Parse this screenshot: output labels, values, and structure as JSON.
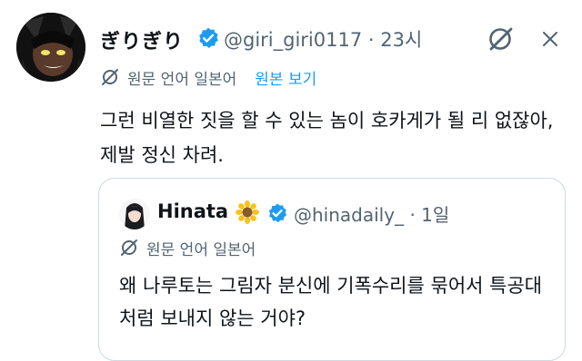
{
  "tweet": {
    "display_name": "ぎりぎり",
    "handle": "@giri_giri0117",
    "separator": "·",
    "time": "23시",
    "translation": {
      "language_note": "원문 언어 일본어",
      "show_original": "원본 보기"
    },
    "text": "그런 비열한 짓을 할 수 있는 놈이 호카게가 될 리 없잖아, 제발 정신 차려."
  },
  "quote": {
    "display_name": "Hinata",
    "handle": "@hinadaily_",
    "separator": "·",
    "time": "1일",
    "translation": {
      "language_note": "원문 언어 일본어"
    },
    "text": "왜 나루토는 그림자 분신에 기폭수리를 묶어서 특공대처럼 보내지 않는 거야?"
  },
  "icons": {
    "verified": "verified-badge-icon",
    "translate": "translate-icon",
    "grok": "grok-icon",
    "more": "more-icon",
    "sunflower": "sunflower-emoji"
  },
  "colors": {
    "verified": "#1d9bf0",
    "link": "#1d9bf0",
    "secondary_text": "#536471",
    "border": "#cfd9de"
  }
}
